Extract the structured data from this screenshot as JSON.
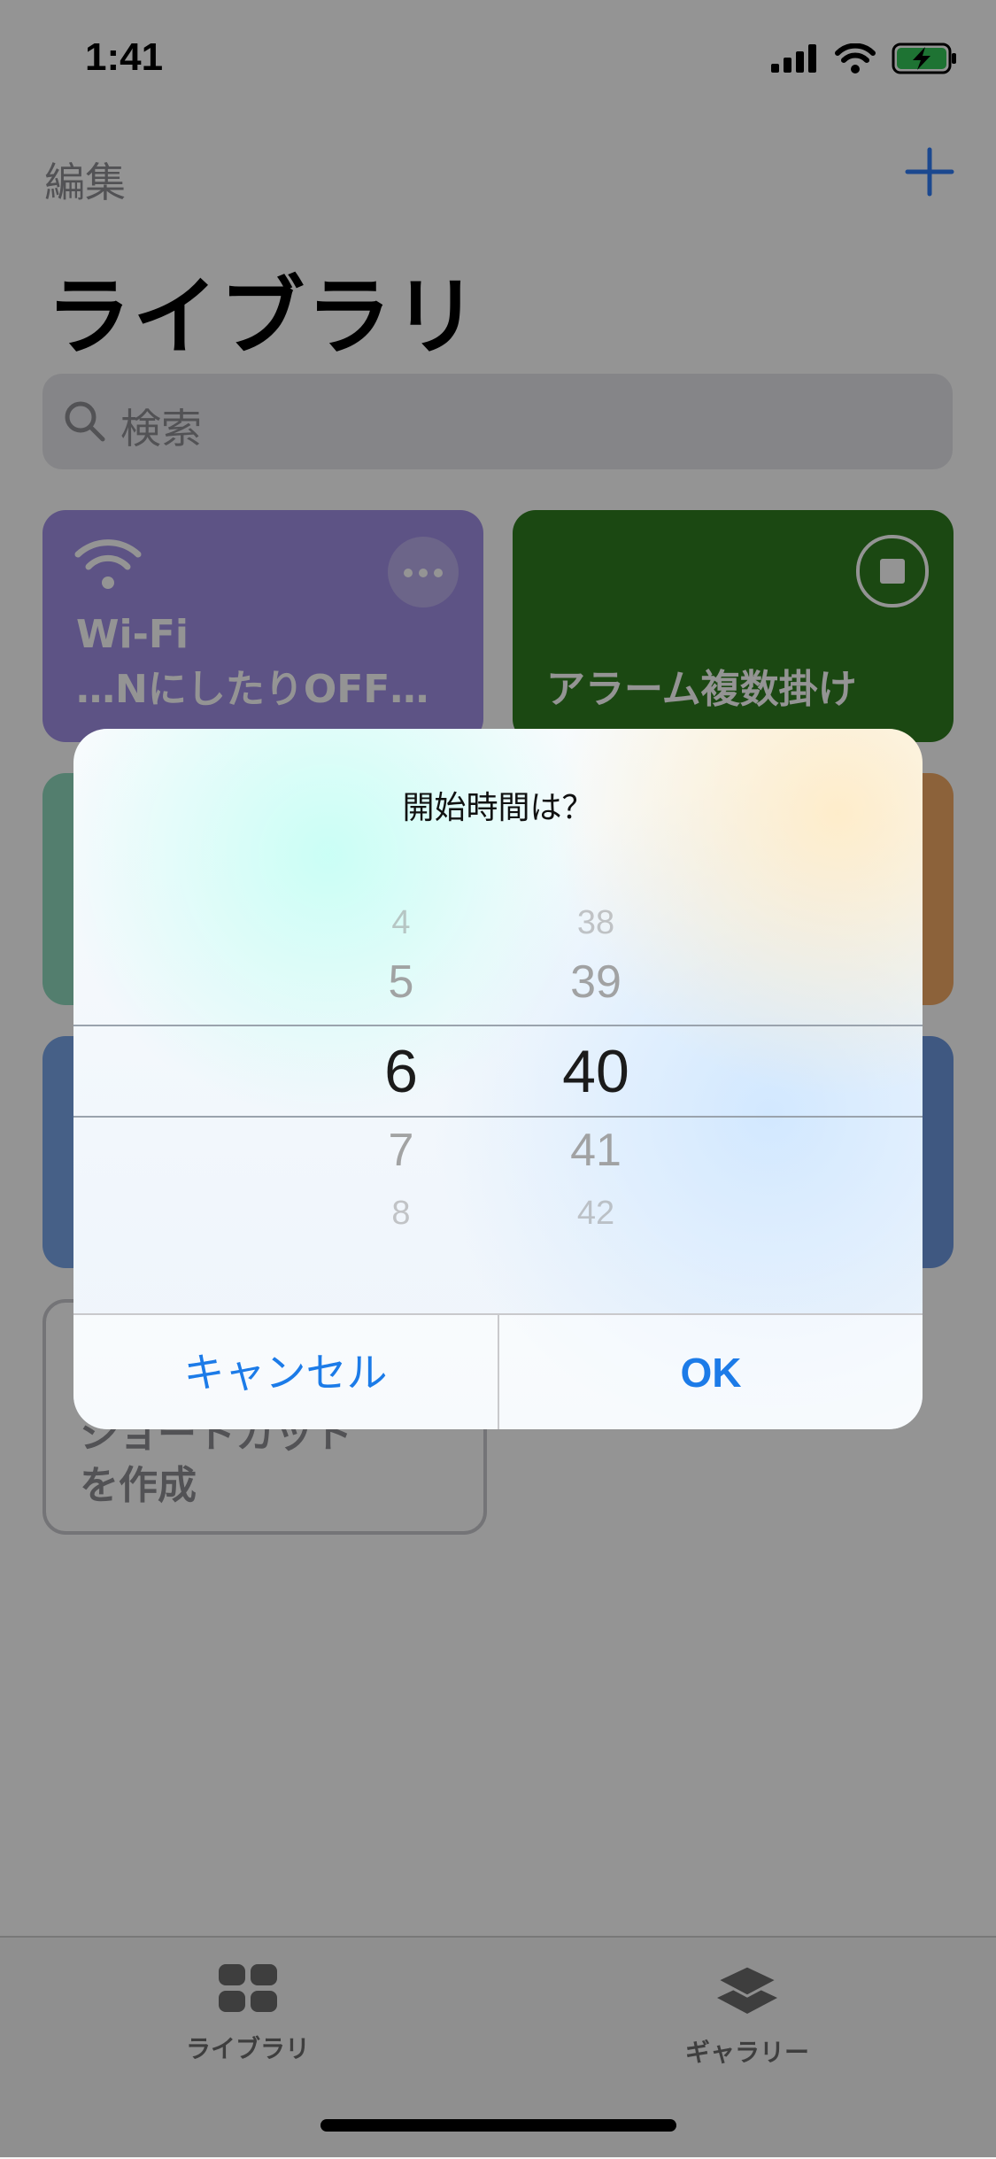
{
  "status_bar": {
    "time": "1:41"
  },
  "nav": {
    "edit_label": "編集",
    "title": "ライブラリ"
  },
  "search": {
    "placeholder": "検索"
  },
  "cards": {
    "wifi": {
      "line1": "Wi-Fi",
      "line2": "…NにしたりOFF…",
      "color": "#a18fe6"
    },
    "alarm": {
      "title": "アラーム複数掛け",
      "color": "#2f7d1f"
    },
    "green": {
      "color": "#8fd9bd"
    },
    "orange": {
      "color": "#f1a964"
    },
    "blue1": {
      "color": "#79a6e8"
    },
    "blue2": {
      "color": "#6d98de"
    },
    "create": {
      "line1": "ショートカット",
      "line2": "を作成"
    }
  },
  "dialog": {
    "title": "開始時間は？",
    "hour_values": [
      "4",
      "5",
      "6",
      "7",
      "8"
    ],
    "minute_values": [
      "38",
      "39",
      "40",
      "41",
      "42"
    ],
    "selected_hour": "6",
    "selected_minute": "40",
    "cancel_label": "キャンセル",
    "ok_label": "OK",
    "accent_color": "#1c7be8"
  },
  "tabbar": {
    "library_label": "ライブラリ",
    "gallery_label": "ギャラリー"
  }
}
